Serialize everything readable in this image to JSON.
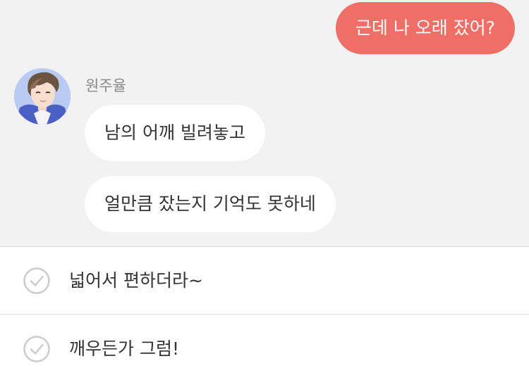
{
  "chat": {
    "outgoing": [
      {
        "text": "근데 나 오래 잤어?"
      }
    ],
    "sender": {
      "name": "원주율",
      "avatar_icon": "character-avatar"
    },
    "incoming": [
      {
        "text": "남의 어깨 빌려놓고"
      },
      {
        "text": "얼만큼 잤는지 기억도 못하네"
      }
    ]
  },
  "choices": [
    {
      "label": "넓어서 편하더라~",
      "icon": "check-circle-icon"
    },
    {
      "label": "깨우든가 그럼!",
      "icon": "check-circle-icon"
    }
  ],
  "colors": {
    "outgoing_bubble": "#ef6f67",
    "chat_background": "#f2f2f2",
    "incoming_bubble": "#ffffff"
  }
}
